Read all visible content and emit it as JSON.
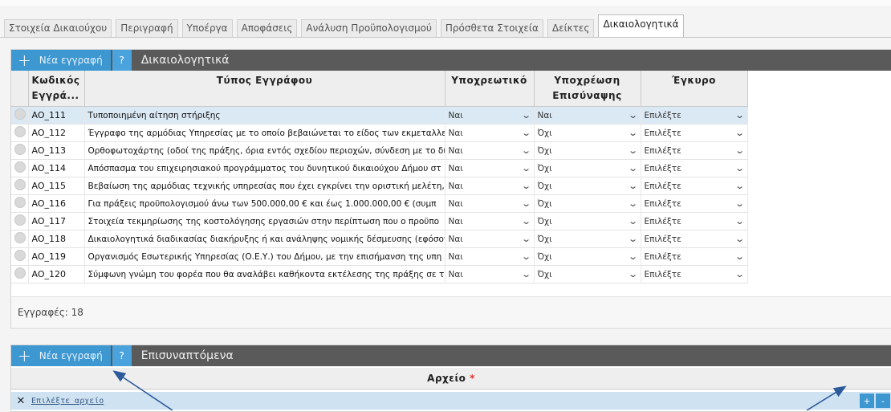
{
  "tabs": [
    {
      "label": "Στοιχεία Δικαιούχου"
    },
    {
      "label": "Περιγραφή"
    },
    {
      "label": "Υποέργα"
    },
    {
      "label": "Αποφάσεις"
    },
    {
      "label": "Ανάλυση Προϋπολογισμού"
    },
    {
      "label": "Πρόσθετα Στοιχεία"
    },
    {
      "label": "Δείκτες"
    },
    {
      "label": "Δικαιολογητικά"
    }
  ],
  "grid1": {
    "new_record": "Νέα εγγραφή",
    "help": "?",
    "title": "Δικαιολογητικά",
    "columns": {
      "code_l1": "Κωδικός",
      "code_l2": "Εγγρά...",
      "type": "Τύπος Εγγράφου",
      "mandatory": "Υποχρεωτικό",
      "attach_l1": "Υποχρέωση",
      "attach_l2": "Επισύναψης",
      "valid": "Έγκυρο"
    },
    "rows": [
      {
        "code": "AO_111",
        "type": "Τυποποιημένη αίτηση στήριξης",
        "mandatory": "Ναι",
        "attach": "Ναι",
        "valid": "Επιλέξτε"
      },
      {
        "code": "AO_112",
        "type": "Έγγραφο της αρμόδιας Υπηρεσίας με το οποίο βεβαιώνεται το είδος των εκμεταλλεύ",
        "mandatory": "Ναι",
        "attach": "Όχι",
        "valid": "Επιλέξτε"
      },
      {
        "code": "AO_113",
        "type": "Ορθοφωτοχάρτης (οδοί της πράξης, όρια εντός σχεδίου περιοχών, σύνδεση με το δίκ",
        "mandatory": "Ναι",
        "attach": "Όχι",
        "valid": "Επιλέξτε"
      },
      {
        "code": "AO_114",
        "type": "Απόσπασμα του επιχειρησιακού προγράμματος του δυνητικού δικαιούχου Δήμου στ",
        "mandatory": "Ναι",
        "attach": "Όχι",
        "valid": "Επιλέξτε"
      },
      {
        "code": "AO_115",
        "type": "Βεβαίωση της αρμόδιας τεχνικής υπηρεσίας που έχει εγκρίνει την οριστική μελέτη, σι",
        "mandatory": "Ναι",
        "attach": "Όχι",
        "valid": "Επιλέξτε"
      },
      {
        "code": "AO_116",
        "type": "Για πράξεις προϋπολογισμού άνω των 500.000,00 € και έως 1.000.000,00 € (συμπ",
        "mandatory": "Ναι",
        "attach": "Όχι",
        "valid": "Επιλέξτε"
      },
      {
        "code": "AO_117",
        "type": "Στοιχεία τεκμηρίωσης  της κοστολόγησης εργασιών στην περίπτωση που ο προϋπο",
        "mandatory": "Ναι",
        "attach": "Όχι",
        "valid": "Επιλέξτε"
      },
      {
        "code": "AO_118",
        "type": "Δικαιολογητικά διαδικασίας διακήρυξης ή και ανάληψης νομικής δέσμευσης (εφόσον",
        "mandatory": "Ναι",
        "attach": "Όχι",
        "valid": "Επιλέξτε"
      },
      {
        "code": "AO_119",
        "type": "Οργανισμός Εσωτερικής Υπηρεσίας (Ο.Ε.Υ.) του Δήμου, με την επισήμανση της υπη",
        "mandatory": "Ναι",
        "attach": "Όχι",
        "valid": "Επιλέξτε"
      },
      {
        "code": "AO_120",
        "type": "Σύμφωνη γνώμη του φορέα που θα αναλάβει καθήκοντα εκτέλεσης της πράξης σε τ",
        "mandatory": "Ναι",
        "attach": "Όχι",
        "valid": "Επιλέξτε"
      }
    ],
    "records": "Εγγραφές: 18"
  },
  "grid2": {
    "new_record": "Νέα εγγραφή",
    "help": "?",
    "title": "Επισυναπτόμενα",
    "file_col": "Αρχείο",
    "required_mark": "*",
    "choose_file": "Επιλέξτε αρχείο",
    "add": "+",
    "remove": "-"
  },
  "colors": {
    "accent": "#3d97d1",
    "header": "#5a5a5a",
    "selected_row": "#dbe9f4",
    "annotation_arrow": "#2d5a9a"
  }
}
